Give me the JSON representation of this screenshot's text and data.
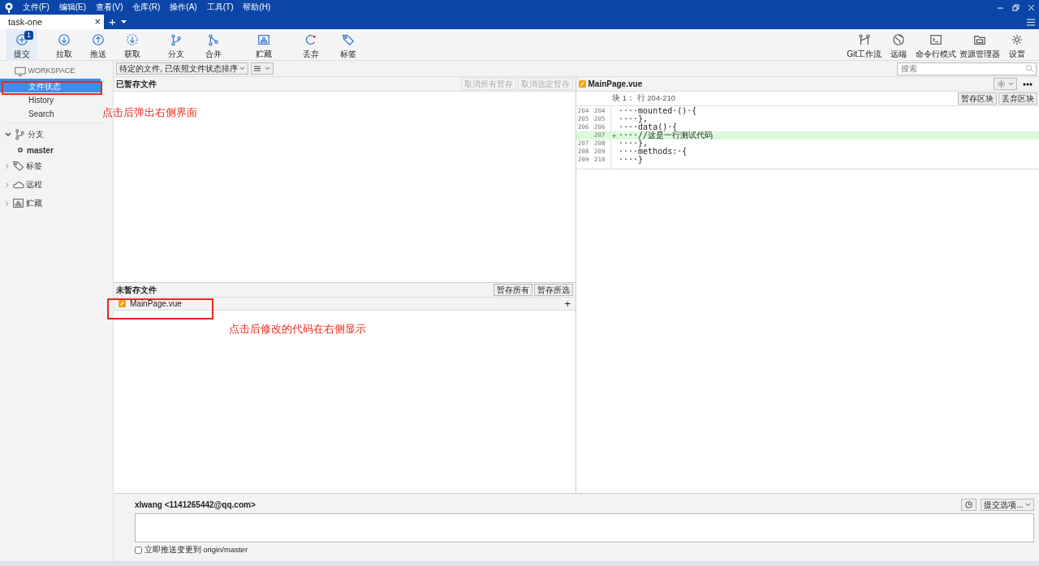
{
  "menu": [
    "文件(F)",
    "编辑(E)",
    "查看(V)",
    "仓库(R)",
    "操作(A)",
    "工具(T)",
    "帮助(H)"
  ],
  "tabs": [
    {
      "label": "task-one",
      "selected": true,
      "close": "×"
    }
  ],
  "tab_add": "+",
  "toolbar_left": [
    {
      "label": "提交",
      "badge": "1",
      "selected": true
    },
    {
      "label": "拉取",
      "selected": false
    },
    {
      "label": "推送",
      "selected": false
    },
    {
      "label": "获取",
      "selected": false
    },
    {
      "label": "分支",
      "selected": false
    },
    {
      "label": "合并",
      "selected": false
    },
    {
      "label": "贮藏",
      "selected": false
    },
    {
      "label": "丢弃",
      "selected": false
    },
    {
      "label": "标签",
      "selected": false
    }
  ],
  "toolbar_right": [
    {
      "label": "Git工作流",
      "selected": false
    },
    {
      "label": "远端",
      "selected": false
    },
    {
      "label": "命令行模式",
      "selected": false
    },
    {
      "label": "资源管理器",
      "selected": false
    },
    {
      "label": "设置",
      "selected": false
    }
  ],
  "search": {
    "placeholder": "搜索"
  },
  "sidebar": {
    "workspace": "WORKSPACE",
    "items": [
      {
        "label": "文件状态",
        "selected": true
      },
      {
        "label": "History",
        "selected": false
      },
      {
        "label": "Search",
        "selected": false
      }
    ],
    "groups": [
      {
        "label": "分支",
        "expanded": true,
        "children": [
          {
            "label": "master",
            "current": true
          }
        ]
      },
      {
        "label": "标签",
        "expanded": false
      },
      {
        "label": "远程",
        "expanded": false
      },
      {
        "label": "贮藏",
        "expanded": false
      }
    ]
  },
  "filter": {
    "value": "待定的文件, 已依照文件状态排序"
  },
  "staged": {
    "title": "已暂存文件",
    "buttons": [
      {
        "label": "取消所有暂存",
        "disabled": true
      },
      {
        "label": "取消选定暂存",
        "disabled": true
      }
    ]
  },
  "unstaged": {
    "title": "未暂存文件",
    "buttons": [
      {
        "label": "暂存所有",
        "disabled": false
      },
      {
        "label": "暂存所选",
        "disabled": false
      }
    ],
    "files": [
      {
        "name": "MainPage.vue",
        "action": "+"
      }
    ]
  },
  "diff": {
    "file": "MainPage.vue",
    "hunk": "块 1： 行 204-210",
    "buttons": [
      "暂存区块",
      "丢弃区块"
    ],
    "lines": [
      {
        "old": "204",
        "new": "204",
        "kind": "context",
        "text": "····mounted·()·{"
      },
      {
        "old": "205",
        "new": "205",
        "kind": "context",
        "text": "····},"
      },
      {
        "old": "206",
        "new": "206",
        "kind": "context",
        "text": "····data()·{"
      },
      {
        "new": "207",
        "kind": "added",
        "sign": "+",
        "text": "····//这是一行测试代码"
      },
      {
        "old": "207",
        "new": "208",
        "kind": "context",
        "text": "····},"
      },
      {
        "old": "208",
        "new": "209",
        "kind": "context",
        "text": "····methods:·{"
      },
      {
        "old": "209",
        "new": "210",
        "kind": "context",
        "text": "····}"
      }
    ]
  },
  "commit": {
    "author": "xlwang <1141265442@qq.com>",
    "options": "提交选项...",
    "push_label": "立即推送变更到 origin/master",
    "push_checked": false
  },
  "annotations": [
    {
      "text": "点击后弹出右侧界面"
    },
    {
      "text": "点击后修改的代码在右侧显示"
    }
  ]
}
